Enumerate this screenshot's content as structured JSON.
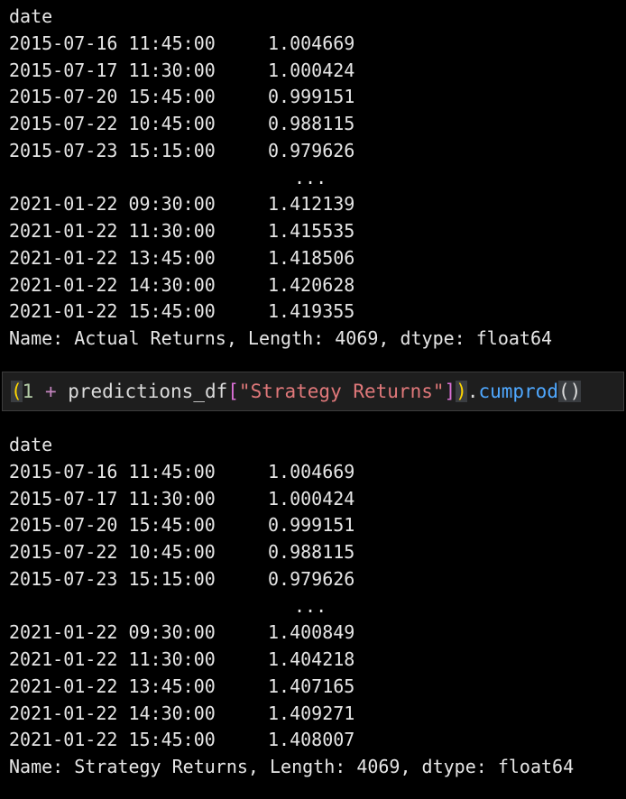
{
  "output1": {
    "header": "date",
    "rows": [
      {
        "date": "2015-07-16 11:45:00",
        "value": "1.004669"
      },
      {
        "date": "2015-07-17 11:30:00",
        "value": "1.000424"
      },
      {
        "date": "2015-07-20 15:45:00",
        "value": "0.999151"
      },
      {
        "date": "2015-07-22 10:45:00",
        "value": "0.988115"
      },
      {
        "date": "2015-07-23 15:15:00",
        "value": "0.979626"
      }
    ],
    "ellipsis": "...",
    "rows_tail": [
      {
        "date": "2021-01-22 09:30:00",
        "value": "1.412139"
      },
      {
        "date": "2021-01-22 11:30:00",
        "value": "1.415535"
      },
      {
        "date": "2021-01-22 13:45:00",
        "value": "1.418506"
      },
      {
        "date": "2021-01-22 14:30:00",
        "value": "1.420628"
      },
      {
        "date": "2021-01-22 15:45:00",
        "value": "1.419355"
      }
    ],
    "footer": "Name: Actual Returns, Length: 4069, dtype: float64"
  },
  "code_cell": {
    "open_paren": "(",
    "number": "1",
    "operator": " + ",
    "identifier": "predictions_df",
    "open_bracket": "[",
    "string": "\"Strategy Returns\"",
    "close_bracket": "]",
    "close_paren": ")",
    "dot": ".",
    "method": "cumprod",
    "call_parens": "()"
  },
  "output2": {
    "header": "date",
    "rows": [
      {
        "date": "2015-07-16 11:45:00",
        "value": "1.004669"
      },
      {
        "date": "2015-07-17 11:30:00",
        "value": "1.000424"
      },
      {
        "date": "2015-07-20 15:45:00",
        "value": "0.999151"
      },
      {
        "date": "2015-07-22 10:45:00",
        "value": "0.988115"
      },
      {
        "date": "2015-07-23 15:15:00",
        "value": "0.979626"
      }
    ],
    "ellipsis": "...",
    "rows_tail": [
      {
        "date": "2021-01-22 09:30:00",
        "value": "1.400849"
      },
      {
        "date": "2021-01-22 11:30:00",
        "value": "1.404218"
      },
      {
        "date": "2021-01-22 13:45:00",
        "value": "1.407165"
      },
      {
        "date": "2021-01-22 14:30:00",
        "value": "1.409271"
      },
      {
        "date": "2021-01-22 15:45:00",
        "value": "1.408007"
      }
    ],
    "footer": "Name: Strategy Returns, Length: 4069, dtype: float64"
  }
}
